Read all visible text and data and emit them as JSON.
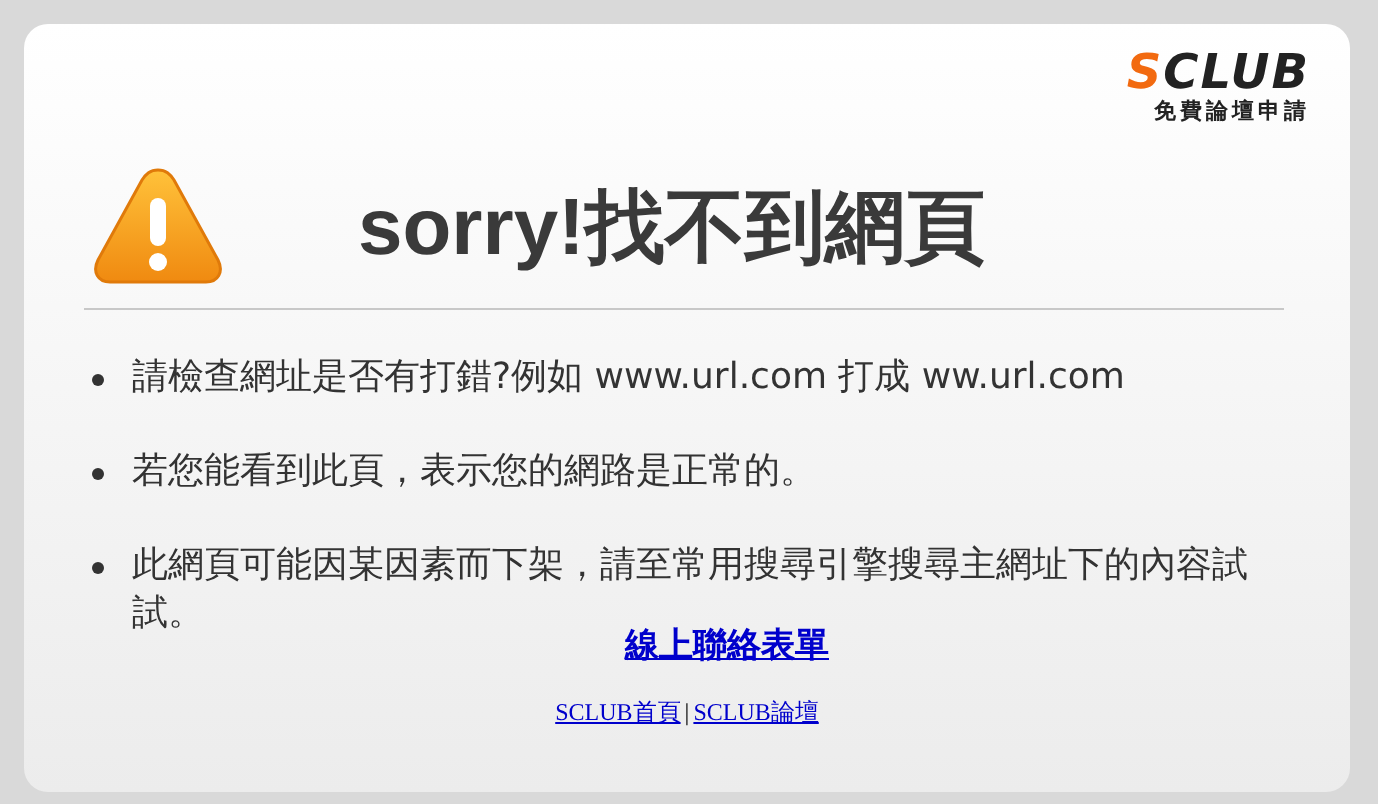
{
  "logo": {
    "name": "SCLUB",
    "tagline": "免費論壇申請"
  },
  "title": "sorry!找不到網頁",
  "tips": [
    "請檢查網址是否有打錯?例如 www.url.com 打成 ww.url.com",
    "若您能看到此頁，表示您的網路是正常的。",
    "此網頁可能因某因素而下架，請至常用搜尋引擎搜尋主網址下的內容試試。"
  ],
  "contact_link": "線上聯絡表單",
  "footer_links": [
    "SCLUB首頁",
    "SCLUB論壇"
  ],
  "footer_separator": "|"
}
